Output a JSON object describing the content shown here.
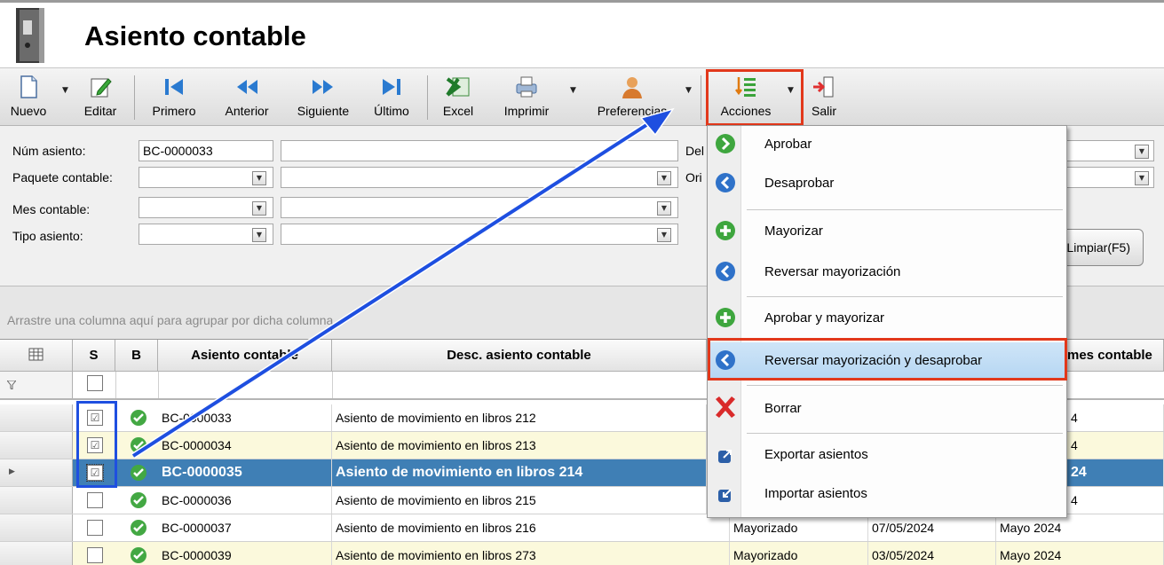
{
  "window": {
    "title": "Asiento contable"
  },
  "toolbar": {
    "nuevo": "Nuevo",
    "editar": "Editar",
    "primero": "Primero",
    "anterior": "Anterior",
    "siguiente": "Siguiente",
    "ultimo": "Último",
    "excel": "Excel",
    "imprimir": "Imprimir",
    "preferencias": "Preferencias",
    "acciones": "Acciones",
    "salir": "Salir"
  },
  "filters": {
    "num_asiento_label": "Núm asiento:",
    "num_asiento_value": "BC-0000033",
    "paquete_label": "Paquete contable:",
    "mes_label": "Mes contable:",
    "tipo_label": "Tipo asiento:",
    "del_label": "Del",
    "ori_label": "Ori",
    "limpiar": "Limpiar(F5)"
  },
  "group_hint": "Arrastre una columna aquí para agrupar por dicha columna",
  "grid": {
    "headers": {
      "s": "S",
      "b": "B",
      "asiento": "Asiento contable",
      "desc": "Desc. asiento contable",
      "mes": "mes contable"
    },
    "rows": [
      {
        "id": "BC-0000033",
        "desc": "Asiento de movimiento en libros 212",
        "estado": "",
        "fecha": "",
        "mes": "4",
        "checked": "☑"
      },
      {
        "id": "BC-0000034",
        "desc": "Asiento de movimiento en libros 213",
        "estado": "",
        "fecha": "",
        "mes": "4",
        "checked": "☑"
      },
      {
        "id": "BC-0000035",
        "desc": "Asiento de movimiento en libros 214",
        "estado": "",
        "fecha": "",
        "mes": "24",
        "checked": "☑"
      },
      {
        "id": "BC-0000036",
        "desc": "Asiento de movimiento en libros 215",
        "estado": "",
        "fecha": "",
        "mes": "4",
        "checked": ""
      },
      {
        "id": "BC-0000037",
        "desc": "Asiento de movimiento en libros 216",
        "estado": "Mayorizado",
        "fecha": "07/05/2024",
        "mes": "Mayo 2024",
        "checked": ""
      },
      {
        "id": "BC-0000039",
        "desc": "Asiento de movimiento en libros 273",
        "estado": "Mayorizado",
        "fecha": "03/05/2024",
        "mes": "Mayo 2024",
        "checked": ""
      }
    ]
  },
  "menu": {
    "aprobar": "Aprobar",
    "desaprobar": "Desaprobar",
    "mayorizar": "Mayorizar",
    "reversar_mayorizacion": "Reversar mayorización",
    "aprobar_mayorizar": "Aprobar y mayorizar",
    "reversar_desaprobar": "Reversar mayorización y desaprobar",
    "borrar": "Borrar",
    "exportar": "Exportar asientos",
    "importar": "Importar asientos"
  },
  "colors": {
    "selected_row": "#3f7fb5",
    "highlight_red": "#e2381b",
    "annotation_blue": "#1e4fe0",
    "alt_row": "#fbf9dc"
  }
}
